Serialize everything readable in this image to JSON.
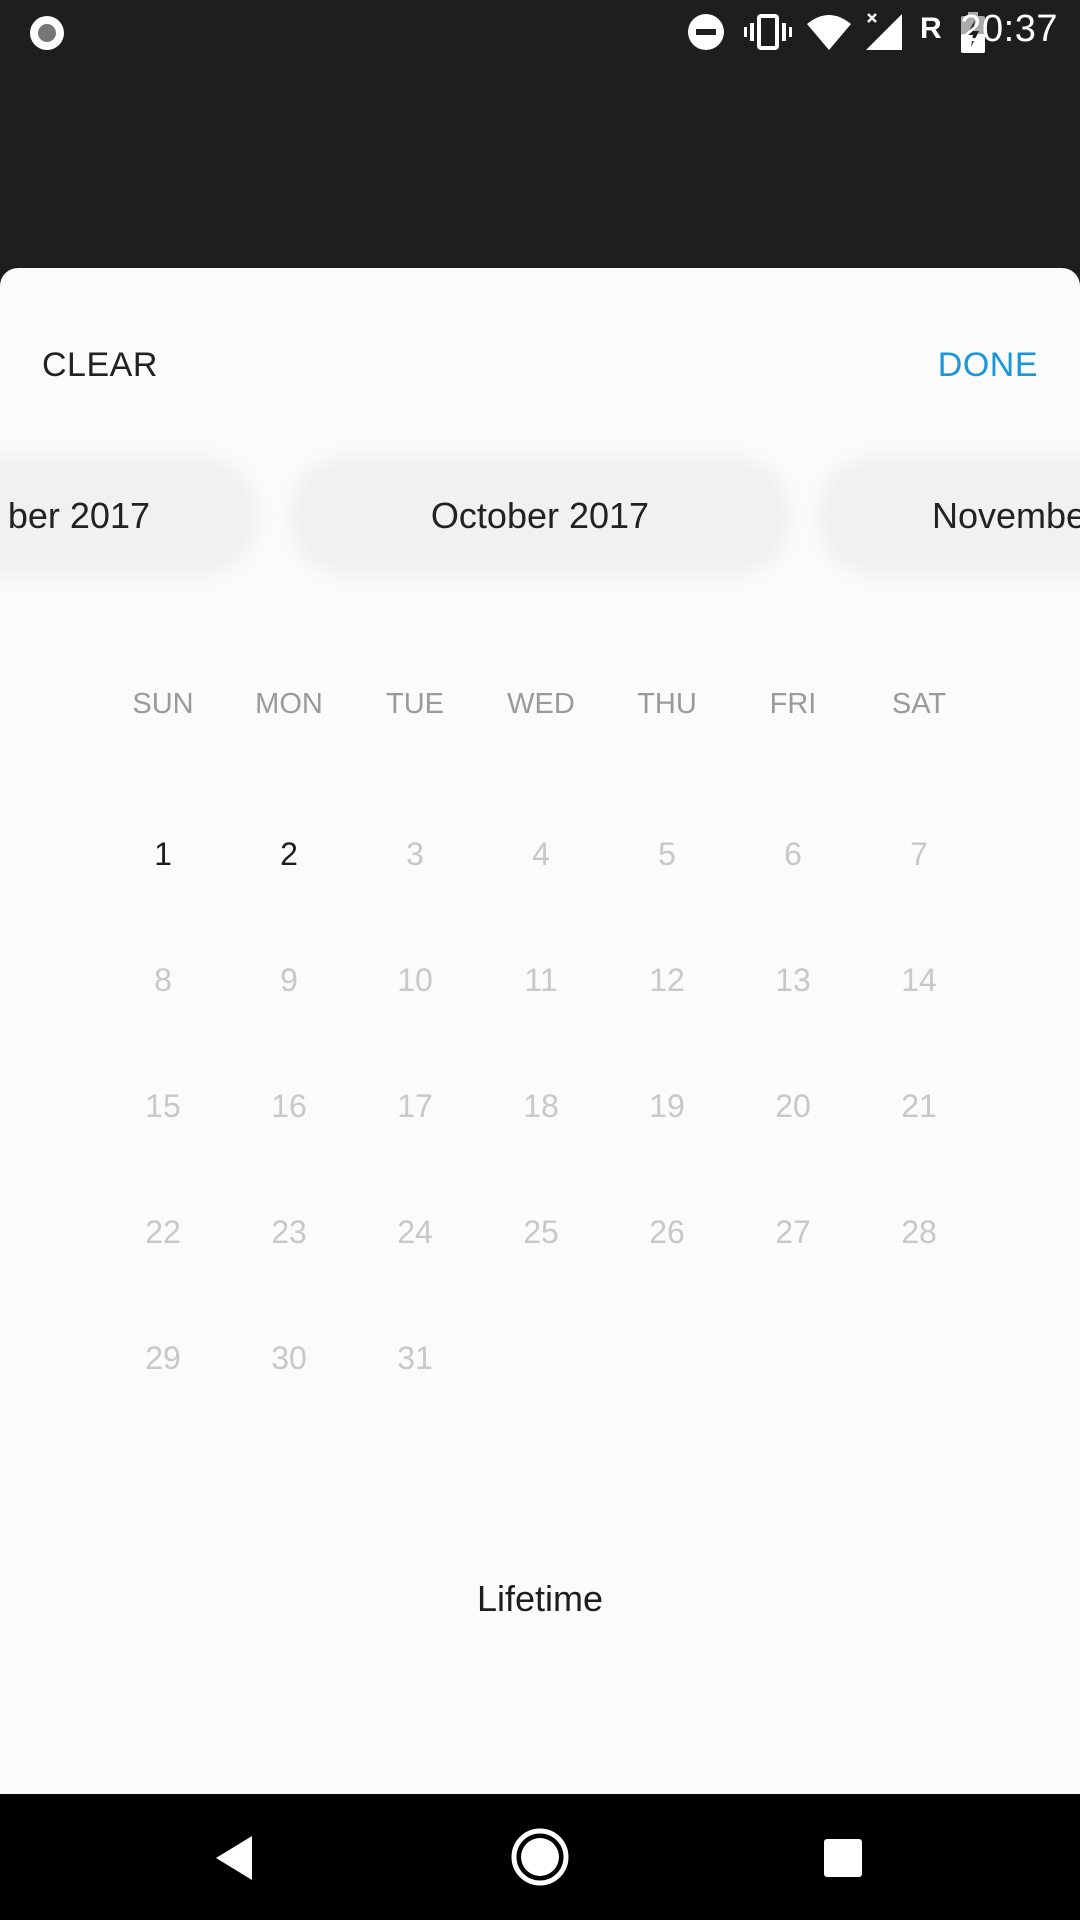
{
  "status_bar": {
    "time": "20:37",
    "network_label": "R",
    "icons": [
      "record-icon",
      "do-not-disturb-icon",
      "vibrate-icon",
      "wifi-icon",
      "signal-icon",
      "battery-charging-icon"
    ]
  },
  "sheet": {
    "clear_label": "CLEAR",
    "done_label": "DONE",
    "accent_color": "#1a97db",
    "months": {
      "prev": "ber 2017",
      "current": "October 2017",
      "next": "Novembe"
    },
    "weekdays": [
      "SUN",
      "MON",
      "TUE",
      "WED",
      "THU",
      "FRI",
      "SAT"
    ],
    "days": [
      "1",
      "2",
      "3",
      "4",
      "5",
      "6",
      "7",
      "8",
      "9",
      "10",
      "11",
      "12",
      "13",
      "14",
      "15",
      "16",
      "17",
      "18",
      "19",
      "20",
      "21",
      "22",
      "23",
      "24",
      "25",
      "26",
      "27",
      "28",
      "29",
      "30",
      "31"
    ],
    "enabled_days": [
      "1",
      "2"
    ],
    "first_weekday_index": 0,
    "lifetime_label": "Lifetime"
  },
  "nav_bar": {
    "icons": [
      "back-icon",
      "home-icon",
      "recents-icon"
    ]
  }
}
